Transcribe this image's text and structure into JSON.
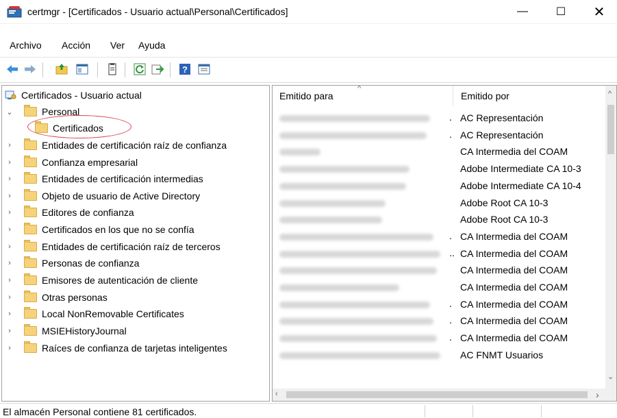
{
  "window": {
    "title": "certmgr - [Certificados - Usuario actual\\Personal\\Certificados]",
    "controls": {
      "minimize": "—",
      "maximize": "☐",
      "close": "✕"
    }
  },
  "menu": [
    "Archivo",
    "Acción",
    "Ver",
    "Ayuda"
  ],
  "toolbar": {
    "icons": [
      "back-arrow-icon",
      "forward-arrow-icon",
      "up-folder-icon",
      "show-hide-tree-icon",
      "export-list-icon",
      "copy-icon",
      "refresh-icon",
      "export-icon",
      "help-icon",
      "properties-icon"
    ]
  },
  "tree": {
    "root": "Certificados - Usuario actual",
    "personal": "Personal",
    "selected": "Certificados",
    "items": [
      "Entidades de certificación raíz de confianza",
      "Confianza empresarial",
      "Entidades de certificación intermedias",
      "Objeto de usuario de Active Directory",
      "Editores de confianza",
      "Certificados en los que no se confía",
      "Entidades de certificación raíz de terceros",
      "Personas de confianza",
      "Emisores de autenticación de cliente",
      "Otras personas",
      "Local NonRemovable Certificates",
      "MSIEHistoryJournal",
      "Raíces de confianza de tarjetas inteligentes"
    ]
  },
  "list": {
    "headers": {
      "issued_to": "Emitido para",
      "issued_by": "Emitido por"
    },
    "rows": [
      {
        "issued_by": "AC Representación",
        "ellipsis": "."
      },
      {
        "issued_by": "AC Representación",
        "ellipsis": "."
      },
      {
        "issued_by": "CA Intermedia del COAM",
        "ellipsis": ""
      },
      {
        "issued_by": "Adobe Intermediate CA 10-3",
        "ellipsis": ""
      },
      {
        "issued_by": "Adobe Intermediate CA 10-4",
        "ellipsis": ""
      },
      {
        "issued_by": "Adobe Root CA 10-3",
        "ellipsis": ""
      },
      {
        "issued_by": "Adobe Root CA 10-3",
        "ellipsis": ""
      },
      {
        "issued_by": "CA Intermedia del COAM",
        "ellipsis": "."
      },
      {
        "issued_by": "CA Intermedia del COAM",
        "ellipsis": ".."
      },
      {
        "issued_by": "CA Intermedia del COAM",
        "ellipsis": ""
      },
      {
        "issued_by": "CA Intermedia del COAM",
        "ellipsis": ""
      },
      {
        "issued_by": "CA Intermedia del COAM",
        "ellipsis": "."
      },
      {
        "issued_by": "CA Intermedia del COAM",
        "ellipsis": "."
      },
      {
        "issued_by": "CA Intermedia del COAM",
        "ellipsis": "."
      },
      {
        "issued_by": "AC FNMT Usuarios",
        "ellipsis": ""
      }
    ]
  },
  "status": "El almacén Personal contiene 81 certificados.",
  "colors": {
    "highlight_ring": "#d64554",
    "folder": "#f6d37a"
  }
}
